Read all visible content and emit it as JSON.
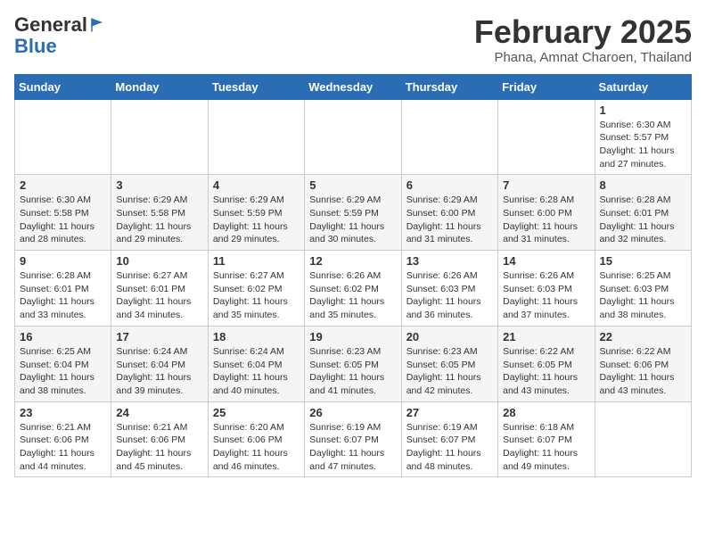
{
  "header": {
    "logo_general": "General",
    "logo_blue": "Blue",
    "month_title": "February 2025",
    "location": "Phana, Amnat Charoen, Thailand"
  },
  "weekdays": [
    "Sunday",
    "Monday",
    "Tuesday",
    "Wednesday",
    "Thursday",
    "Friday",
    "Saturday"
  ],
  "weeks": [
    [
      {
        "day": "",
        "info": ""
      },
      {
        "day": "",
        "info": ""
      },
      {
        "day": "",
        "info": ""
      },
      {
        "day": "",
        "info": ""
      },
      {
        "day": "",
        "info": ""
      },
      {
        "day": "",
        "info": ""
      },
      {
        "day": "1",
        "info": "Sunrise: 6:30 AM\nSunset: 5:57 PM\nDaylight: 11 hours and 27 minutes."
      }
    ],
    [
      {
        "day": "2",
        "info": "Sunrise: 6:30 AM\nSunset: 5:58 PM\nDaylight: 11 hours and 28 minutes."
      },
      {
        "day": "3",
        "info": "Sunrise: 6:29 AM\nSunset: 5:58 PM\nDaylight: 11 hours and 29 minutes."
      },
      {
        "day": "4",
        "info": "Sunrise: 6:29 AM\nSunset: 5:59 PM\nDaylight: 11 hours and 29 minutes."
      },
      {
        "day": "5",
        "info": "Sunrise: 6:29 AM\nSunset: 5:59 PM\nDaylight: 11 hours and 30 minutes."
      },
      {
        "day": "6",
        "info": "Sunrise: 6:29 AM\nSunset: 6:00 PM\nDaylight: 11 hours and 31 minutes."
      },
      {
        "day": "7",
        "info": "Sunrise: 6:28 AM\nSunset: 6:00 PM\nDaylight: 11 hours and 31 minutes."
      },
      {
        "day": "8",
        "info": "Sunrise: 6:28 AM\nSunset: 6:01 PM\nDaylight: 11 hours and 32 minutes."
      }
    ],
    [
      {
        "day": "9",
        "info": "Sunrise: 6:28 AM\nSunset: 6:01 PM\nDaylight: 11 hours and 33 minutes."
      },
      {
        "day": "10",
        "info": "Sunrise: 6:27 AM\nSunset: 6:01 PM\nDaylight: 11 hours and 34 minutes."
      },
      {
        "day": "11",
        "info": "Sunrise: 6:27 AM\nSunset: 6:02 PM\nDaylight: 11 hours and 35 minutes."
      },
      {
        "day": "12",
        "info": "Sunrise: 6:26 AM\nSunset: 6:02 PM\nDaylight: 11 hours and 35 minutes."
      },
      {
        "day": "13",
        "info": "Sunrise: 6:26 AM\nSunset: 6:03 PM\nDaylight: 11 hours and 36 minutes."
      },
      {
        "day": "14",
        "info": "Sunrise: 6:26 AM\nSunset: 6:03 PM\nDaylight: 11 hours and 37 minutes."
      },
      {
        "day": "15",
        "info": "Sunrise: 6:25 AM\nSunset: 6:03 PM\nDaylight: 11 hours and 38 minutes."
      }
    ],
    [
      {
        "day": "16",
        "info": "Sunrise: 6:25 AM\nSunset: 6:04 PM\nDaylight: 11 hours and 38 minutes."
      },
      {
        "day": "17",
        "info": "Sunrise: 6:24 AM\nSunset: 6:04 PM\nDaylight: 11 hours and 39 minutes."
      },
      {
        "day": "18",
        "info": "Sunrise: 6:24 AM\nSunset: 6:04 PM\nDaylight: 11 hours and 40 minutes."
      },
      {
        "day": "19",
        "info": "Sunrise: 6:23 AM\nSunset: 6:05 PM\nDaylight: 11 hours and 41 minutes."
      },
      {
        "day": "20",
        "info": "Sunrise: 6:23 AM\nSunset: 6:05 PM\nDaylight: 11 hours and 42 minutes."
      },
      {
        "day": "21",
        "info": "Sunrise: 6:22 AM\nSunset: 6:05 PM\nDaylight: 11 hours and 43 minutes."
      },
      {
        "day": "22",
        "info": "Sunrise: 6:22 AM\nSunset: 6:06 PM\nDaylight: 11 hours and 43 minutes."
      }
    ],
    [
      {
        "day": "23",
        "info": "Sunrise: 6:21 AM\nSunset: 6:06 PM\nDaylight: 11 hours and 44 minutes."
      },
      {
        "day": "24",
        "info": "Sunrise: 6:21 AM\nSunset: 6:06 PM\nDaylight: 11 hours and 45 minutes."
      },
      {
        "day": "25",
        "info": "Sunrise: 6:20 AM\nSunset: 6:06 PM\nDaylight: 11 hours and 46 minutes."
      },
      {
        "day": "26",
        "info": "Sunrise: 6:19 AM\nSunset: 6:07 PM\nDaylight: 11 hours and 47 minutes."
      },
      {
        "day": "27",
        "info": "Sunrise: 6:19 AM\nSunset: 6:07 PM\nDaylight: 11 hours and 48 minutes."
      },
      {
        "day": "28",
        "info": "Sunrise: 6:18 AM\nSunset: 6:07 PM\nDaylight: 11 hours and 49 minutes."
      },
      {
        "day": "",
        "info": ""
      }
    ]
  ]
}
